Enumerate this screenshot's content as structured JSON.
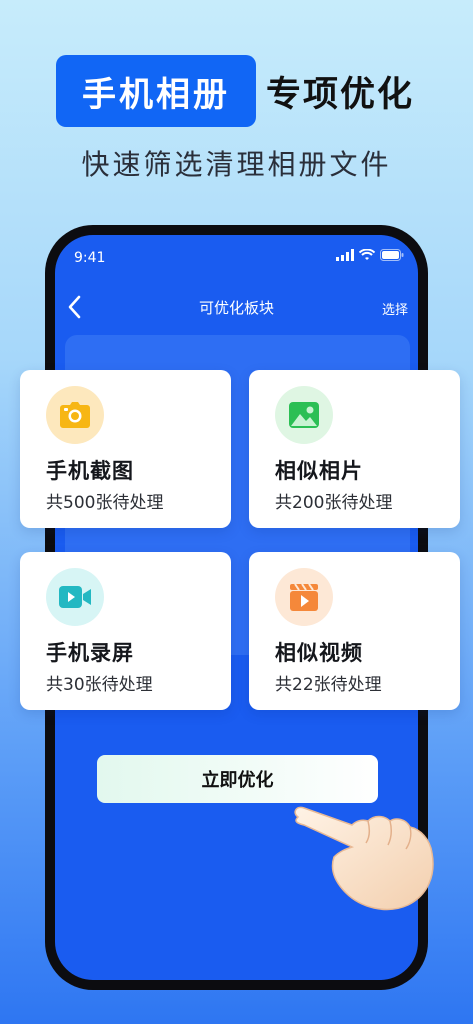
{
  "headline": {
    "badge": "手机相册",
    "rest": "专项优化"
  },
  "subheadline": "快速筛选清理相册文件",
  "phone": {
    "status_time": "9:41",
    "nav": {
      "title": "可优化板块",
      "action": "选择"
    }
  },
  "cards": [
    {
      "name": "手机截图",
      "count": "共500张待处理",
      "icon": "camera-icon",
      "color": "#fde8bd",
      "accent": "#f7b614"
    },
    {
      "name": "相似相片",
      "count": "共200张待处理",
      "icon": "image-icon",
      "color": "#dff6e3",
      "accent": "#2bbf54"
    },
    {
      "name": "手机录屏",
      "count": "共30张待处理",
      "icon": "video-camera-icon",
      "color": "#d7f5f5",
      "accent": "#23b8c2"
    },
    {
      "name": "相似视频",
      "count": "共22张待处理",
      "icon": "clapperboard-icon",
      "color": "#fde8d6",
      "accent": "#f5883a"
    }
  ],
  "cta": {
    "label": "立即优化"
  },
  "colors": {
    "brand": "#1166f5",
    "screen": "#1a5cf0"
  }
}
